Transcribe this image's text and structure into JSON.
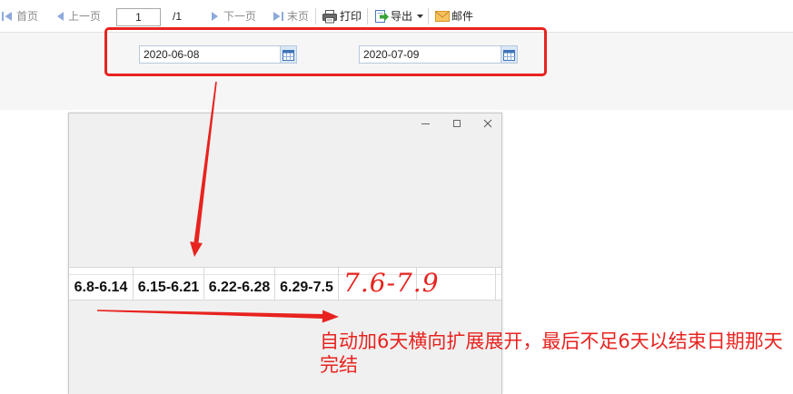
{
  "toolbar": {
    "first_page": {
      "label": "首页",
      "icon": "first-page-icon"
    },
    "prev_page": {
      "label": "上一页",
      "icon": "prev-page-icon"
    },
    "page_input": {
      "value": "1"
    },
    "page_total": "/1",
    "next_page": {
      "label": "下一页",
      "icon": "next-page-icon"
    },
    "last_page": {
      "label": "末页",
      "icon": "last-page-icon"
    },
    "print": {
      "label": "打印",
      "icon": "printer-icon"
    },
    "export": {
      "label": "导出",
      "icon": "export-icon",
      "dropdown_icon": "chevron-down-icon"
    },
    "mail": {
      "label": "邮件",
      "icon": "mail-icon"
    },
    "disabled_text_color": "#8c8c8c",
    "nav_icon_color": "#8eaadb"
  },
  "filters": {
    "start_date": {
      "value": "2020-06-08",
      "icon": "calendar-icon"
    },
    "end_date": {
      "value": "2020-07-09",
      "icon": "calendar-icon"
    }
  },
  "dialog": {
    "window_controls": {
      "minimize_icon": "minimize-icon",
      "maximize_icon": "maximize-icon",
      "close_icon": "close-icon"
    },
    "week_ranges": [
      "6.8-6.14",
      "6.15-6.21",
      "6.22-6.28",
      "6.29-7.5"
    ],
    "handwritten_range": "7.6-7.9"
  },
  "annotation": {
    "color": "#e8231f",
    "lines": [
      "自动加6天横向扩展展开，最后不足6天以结束日期那天",
      "完结"
    ]
  }
}
